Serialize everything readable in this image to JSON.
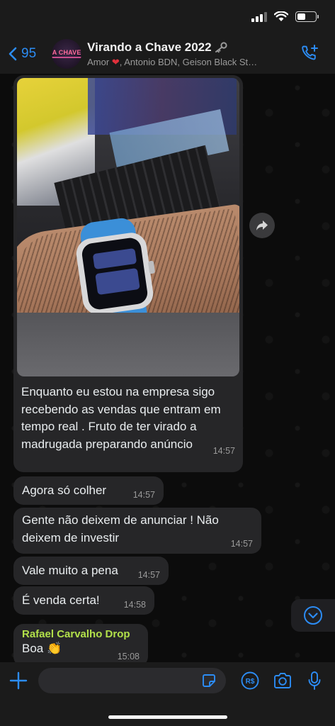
{
  "colors": {
    "accent": "#2c8cf4",
    "bubble": "#262628",
    "sender_name": "#b2e04a",
    "background": "#0c0c0c"
  },
  "status_bar": {
    "icons": [
      "signal-icon",
      "wifi-icon",
      "battery-icon"
    ]
  },
  "header": {
    "back_count": "95",
    "title": "Virando a Chave 2022",
    "title_icon": "key-icon",
    "members_prefix": "Amor",
    "members_rest": ", Antonio BDN, Geison Black St…",
    "avatar_text": "A CHAVE"
  },
  "messages": [
    {
      "type": "image",
      "text": "Enquanto eu estou na empresa sigo recebendo as vendas que entram em tempo real . Fruto de ter virado a madrugada preparando anúncio",
      "time": "14:57"
    },
    {
      "text": "Agora só colher",
      "time": "14:57"
    },
    {
      "text": "Gente não deixem de anunciar ! Não deixem de investir",
      "time": "14:57"
    },
    {
      "text": "Vale muito a pena",
      "time": "14:57"
    },
    {
      "text": "É venda certa!",
      "time": "14:58"
    },
    {
      "sender": "Rafael Carvalho Drop",
      "text": "Boa 👏",
      "time": "15:08"
    }
  ],
  "input": {
    "placeholder": "",
    "value": ""
  }
}
